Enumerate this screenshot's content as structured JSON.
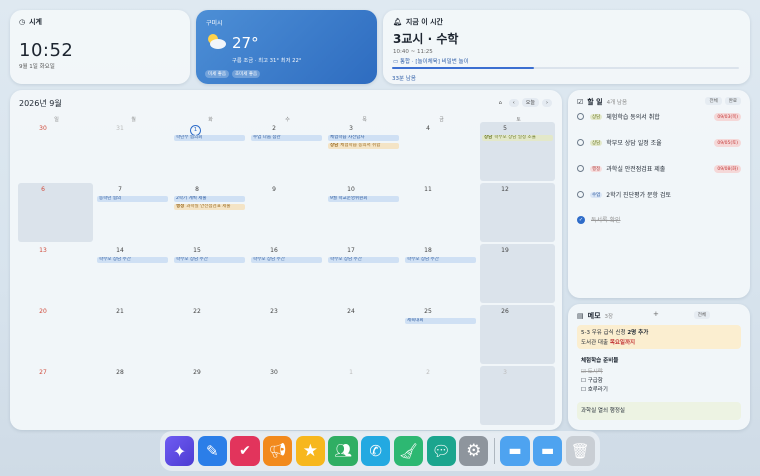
{
  "clock": {
    "title": "시계",
    "time": "10:52",
    "date": "9월 1일 화요일"
  },
  "weather": {
    "location": "구미시",
    "temp": "27°",
    "desc": "구름 조금 · 최고 31° 최저 22°",
    "chips": [
      "미세 좋음",
      "초미세 좋음"
    ]
  },
  "schedule": {
    "title": "지금 이 시간",
    "class": "3교시 · 수학",
    "range": "10:40 ~ 11:25",
    "sub": "통합 · [놀이체육] 비밀번 놀이",
    "remaining": "33분 남음",
    "progress": 0.41
  },
  "calendar": {
    "title": "2026년 9월",
    "today_label": "오늘",
    "dows": [
      "일",
      "월",
      "화",
      "수",
      "목",
      "금",
      "토"
    ],
    "rows": [
      [
        "30",
        "31",
        "1",
        "2",
        "3",
        "4",
        "5"
      ],
      [
        "6",
        "7",
        "8",
        "9",
        "10",
        "11",
        "12"
      ],
      [
        "13",
        "14",
        "15",
        "16",
        "17",
        "18",
        "19"
      ],
      [
        "20",
        "21",
        "22",
        "23",
        "24",
        "25",
        "26"
      ],
      [
        "27",
        "28",
        "29",
        "30",
        "1",
        "2",
        "3"
      ]
    ],
    "events": {
      "w0_tue": "학년부 협의회",
      "w0_wed": "수업 나눔 참관",
      "w0_thu_1": "체험학습 사전답사",
      "w0_thu_2_tag": "상담",
      "w0_thu_2": "체험학습 동의서 취합",
      "w0_sat_tag": "상담",
      "w0_sat": "학부모 상담 일정 조율",
      "w1_mon": "동학년 협의",
      "w1_tue_1": "2학기 계획 제출",
      "w1_tue_2_tag": "행정",
      "w1_tue_2": "과학실 안전점검표 제출",
      "w1_thu": "9월 학교운영위원회",
      "w2_mon": "학부모 상담 주간",
      "w2_tue": "학부모 상담 주간",
      "w2_wed": "학부모 상담 주간",
      "w2_thu": "학부모 상담 주간",
      "w2_fri": "학부모 상담 주간",
      "w3_fri": "제육대회"
    }
  },
  "todo": {
    "title": "할 일",
    "count": "4개 남음",
    "tabs": [
      "전체",
      "완료"
    ],
    "items": [
      {
        "cat": "상담",
        "text": "체험학습 동의서 취합",
        "due": "09/03(목)"
      },
      {
        "cat": "상담",
        "text": "학부모 상담 일정 조율",
        "due": "09/05(토)"
      },
      {
        "cat": "행정",
        "text": "과학실 안전점검표 제출",
        "due": "09/08(화)"
      },
      {
        "cat": "수업",
        "text": "2학기 진단평가 문항 검토",
        "due": ""
      },
      {
        "cat": "",
        "text": "독서록 확인",
        "due": ""
      }
    ]
  },
  "memo": {
    "title": "메모",
    "count": "3장",
    "add": "+",
    "tab": "전체",
    "note1_line1": "5-3 우유 급식 신청 ",
    "note1_bold": "2명 추가",
    "note1_line2": "도서관 대출 ",
    "note1_red": "목요일까지",
    "note2_title": "체험학습 준비물",
    "note2_items": [
      "도시락",
      "구급함",
      "호루라기"
    ],
    "note3": "과학실 열쇠 행정실"
  },
  "colors": {
    "accent": "#2e6cc9",
    "weather_bg": "#3b7cd0"
  }
}
